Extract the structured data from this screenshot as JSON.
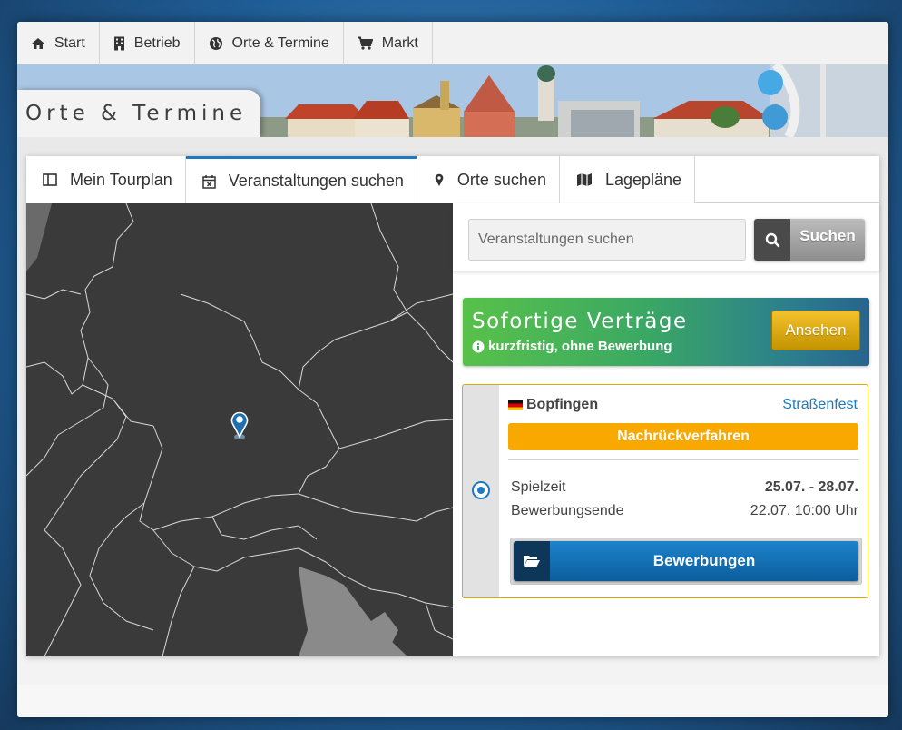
{
  "topnav": {
    "items": [
      {
        "label": "Start",
        "icon": "home-icon"
      },
      {
        "label": "Betrieb",
        "icon": "building-icon"
      },
      {
        "label": "Orte & Termine",
        "icon": "globe-icon"
      },
      {
        "label": "Markt",
        "icon": "cart-icon"
      }
    ]
  },
  "banner": {
    "title": "Orte & Termine"
  },
  "tabs": [
    {
      "label": "Mein Tourplan",
      "icon": "columns-icon"
    },
    {
      "label": "Veranstaltungen suchen",
      "icon": "calendar-x-icon",
      "active": true
    },
    {
      "label": "Orte suchen",
      "icon": "map-marker-icon"
    },
    {
      "label": "Lagepläne",
      "icon": "map-icon"
    }
  ],
  "search": {
    "placeholder": "Veranstaltungen suchen",
    "value": "",
    "button_label": "Suchen"
  },
  "promo": {
    "title": "Sofortige Verträge",
    "subtitle": "kurzfristig, ohne Bewerbung",
    "button_label": "Ansehen"
  },
  "event": {
    "place": "Bopfingen",
    "type": "Straßenfest",
    "status": "Nachrückverfahren",
    "rows": [
      {
        "label": "Spielzeit",
        "value": "25.07. - 28.07."
      },
      {
        "label": "Bewerbungsende",
        "value": "22.07. 10:00 Uhr"
      }
    ],
    "apply_label": "Bewerbungen"
  },
  "colors": {
    "accent": "#1e7abf",
    "status_orange": "#f9a800",
    "promo_green": "#58c14a",
    "promo_blue": "#27648e",
    "map_bg": "#3a3a3a"
  }
}
